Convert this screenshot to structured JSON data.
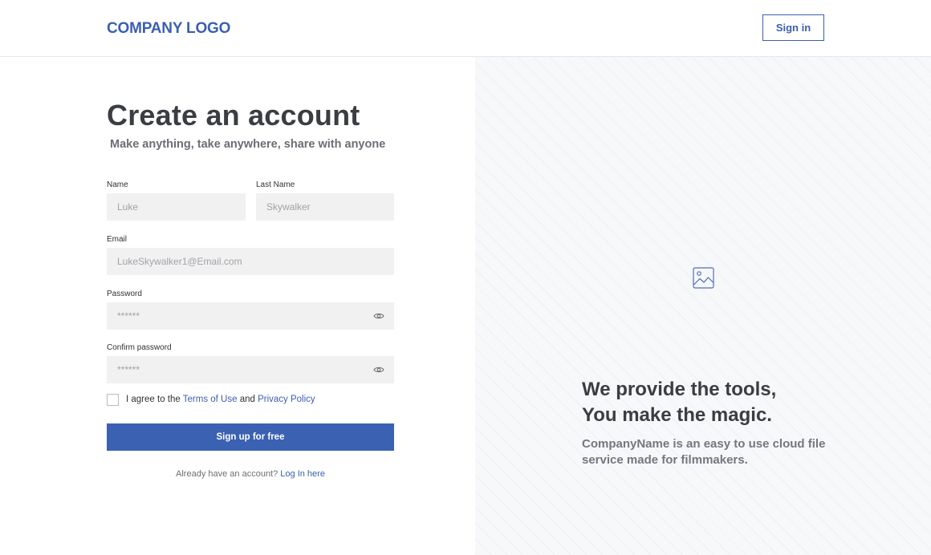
{
  "header": {
    "logo": "COMPANY LOGO",
    "signin_label": "Sign in"
  },
  "form": {
    "title": "Create an account",
    "subtitle": "Make anything, take anywhere, share with anyone",
    "name_label": "Name",
    "name_placeholder": "Luke",
    "lastname_label": "Last Name",
    "lastname_placeholder": "Skywalker",
    "email_label": "Email",
    "email_placeholder": "LukeSkywalker1@Email.com",
    "password_label": "Password",
    "password_placeholder": "******",
    "confirm_label": "Confirm password",
    "confirm_placeholder": "******",
    "agree_prefix": "I agree to the ",
    "terms_link": "Terms of Use",
    "agree_and": " and ",
    "privacy_link": "Privacy Policy",
    "signup_label": "Sign up for free",
    "already_text": "Already have an account? ",
    "login_link": "Log In here"
  },
  "promo": {
    "icon": "image-icon",
    "tagline_line1": "We provide the tools,",
    "tagline_line2": "You make the magic.",
    "description": "CompanyName is an easy to use cloud file service made for filmmakers."
  },
  "colors": {
    "accent": "#3b5fb0",
    "input_bg": "#f1f1f2",
    "panel_bg": "#f7f8fa"
  }
}
